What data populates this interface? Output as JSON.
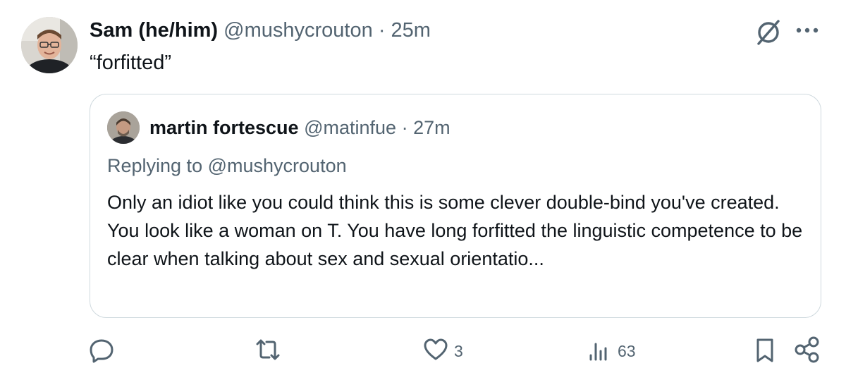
{
  "post": {
    "author_name": "Sam (he/him)",
    "handle": "@mushycrouton",
    "separator": "·",
    "time": "25m",
    "text": "“forfitted”"
  },
  "quote": {
    "author_name": "martin fortescue",
    "handle": "@matinfue",
    "separator": "·",
    "time": "27m",
    "replying_prefix": "Replying to",
    "replying_handle": "@mushycrouton",
    "body_line1": "Only an idiot like you could think this is some clever double-bind you've created.",
    "body_line2": "You look like a woman on T. You have long forfitted the linguistic competence to be clear when talking about sex and sexual orientatio..."
  },
  "actions": {
    "reply_count": "",
    "repost_count": "",
    "like_count": "3",
    "views_count": "63"
  },
  "icons": {
    "grok": "grok-icon",
    "more": "more-icon",
    "reply": "reply-icon",
    "repost": "repost-icon",
    "like": "heart-icon",
    "views": "views-icon",
    "bookmark": "bookmark-icon",
    "share": "share-icon"
  },
  "colors": {
    "text": "#0f1419",
    "muted": "#536471",
    "border": "#cfd9de"
  }
}
